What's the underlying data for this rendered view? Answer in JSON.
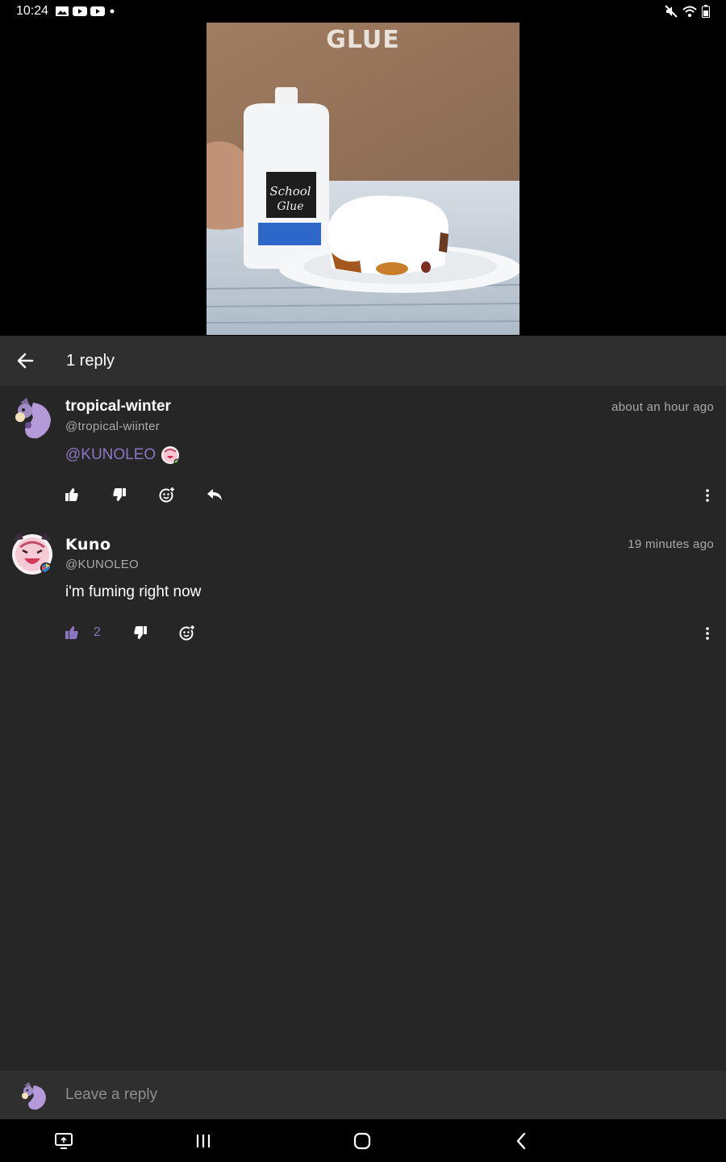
{
  "status_bar": {
    "time": "10:24",
    "left_icons": [
      "gallery-icon",
      "youtube-icon",
      "youtube-icon",
      "dot-icon"
    ],
    "right_icons": [
      "mute-icon",
      "wifi-icon",
      "battery-icon"
    ]
  },
  "video": {
    "caption": "GLUE",
    "bottle_label_line1": "School",
    "bottle_label_line2": "Glue"
  },
  "header": {
    "back_icon": "arrow-left-icon",
    "title": "1 reply"
  },
  "comments": [
    {
      "username": "tropical-winter",
      "handle": "@tropical-wiinter",
      "timestamp": "about an hour ago",
      "mention": "@KUNOLEO",
      "body": "",
      "like_count": "",
      "actions": [
        "thumbs-up-icon",
        "thumbs-down-icon",
        "add-reaction-icon",
        "reply-icon"
      ]
    },
    {
      "username": "Kuno",
      "handle": "@KUNOLEO",
      "timestamp": "19 minutes ago",
      "body": "i'm fuming right now",
      "like_count": "2",
      "actions": [
        "thumbs-up-icon",
        "thumbs-down-icon",
        "add-reaction-icon"
      ]
    }
  ],
  "reply_bar": {
    "placeholder": "Leave a reply"
  },
  "nav_bar": {
    "icons": [
      "screen-share-icon",
      "recent-apps-icon",
      "home-icon",
      "back-icon"
    ]
  },
  "colors": {
    "accent": "#8a76c2",
    "background": "#262626",
    "header": "#2f2f2f"
  }
}
